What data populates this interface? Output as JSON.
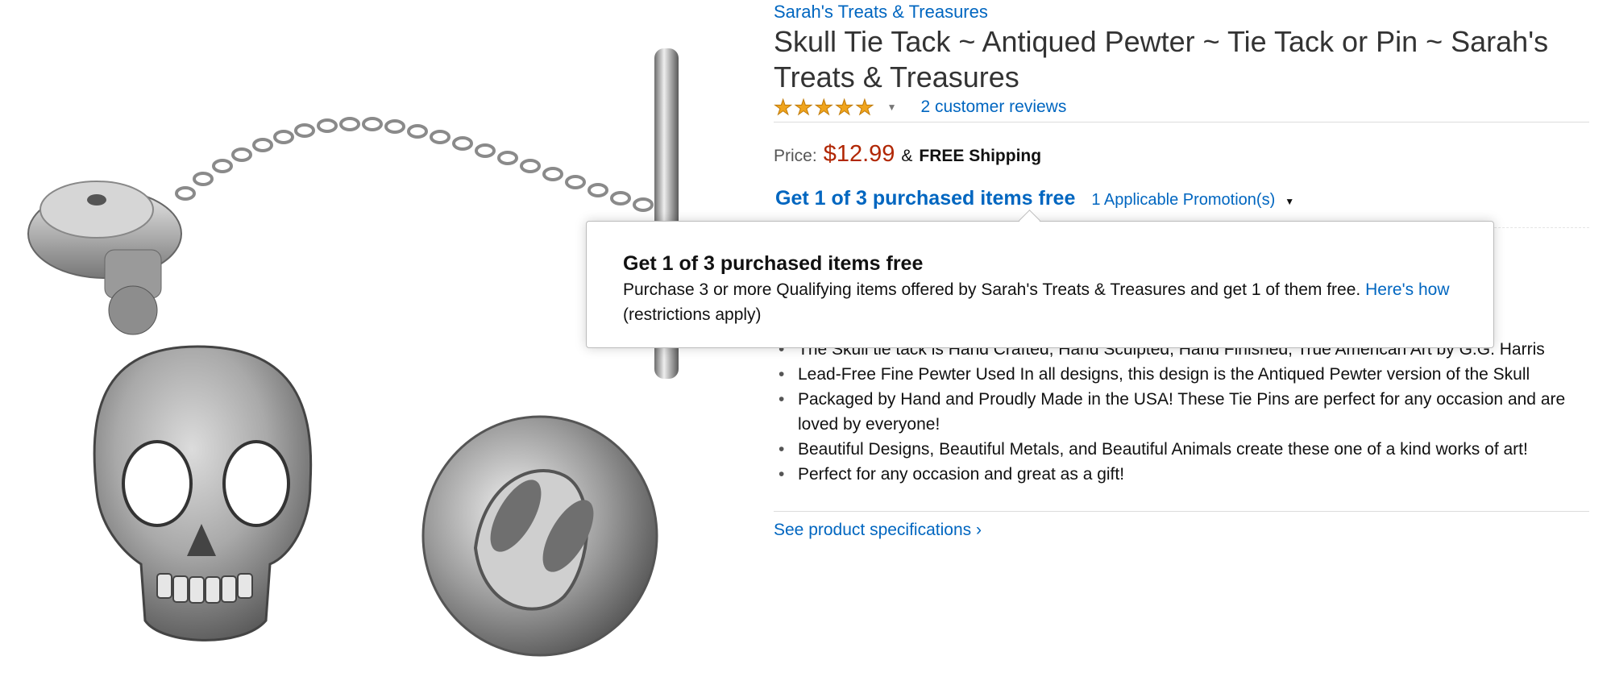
{
  "brand": "Sarah's Treats & Treasures",
  "title": "Skull Tie Tack ~ Antiqued Pewter ~ Tie Tack or Pin ~ Sarah's Treats & Treasures",
  "rating": {
    "stars": 5,
    "reviews_link": "2 customer reviews"
  },
  "price": {
    "label": "Price:",
    "amount": "$12.99",
    "amp": "&",
    "shipping": "FREE Shipping"
  },
  "promotion": {
    "title": "Get 1 of 3 purchased items free",
    "applicable": "1 Applicable Promotion(s)"
  },
  "popover": {
    "title": "Get 1 of 3 purchased items free",
    "body": "Purchase 3 or more Qualifying items offered by Sarah's Treats & Treasures and get 1 of them free.",
    "link": "Here's how",
    "note": "(restrictions apply)"
  },
  "bullets": [
    "The Skull tie tack is Hand Crafted, Hand Sculpted, Hand Finished, True American Art by G.G. Harris",
    "Lead-Free Fine Pewter Used In all designs, this design is the Antiqued Pewter version of the Skull",
    "Packaged by Hand and Proudly Made in the USA! These Tie Pins are perfect for any occasion and are loved by everyone!",
    "Beautiful Designs, Beautiful Metals, and Beautiful Animals create these one of a kind works of art!",
    "Perfect for any occasion and great as a gift!"
  ],
  "specs_link": "See product specifications ›",
  "colors": {
    "link": "#0066c0",
    "price": "#b12704",
    "star": "#f0a41c"
  }
}
